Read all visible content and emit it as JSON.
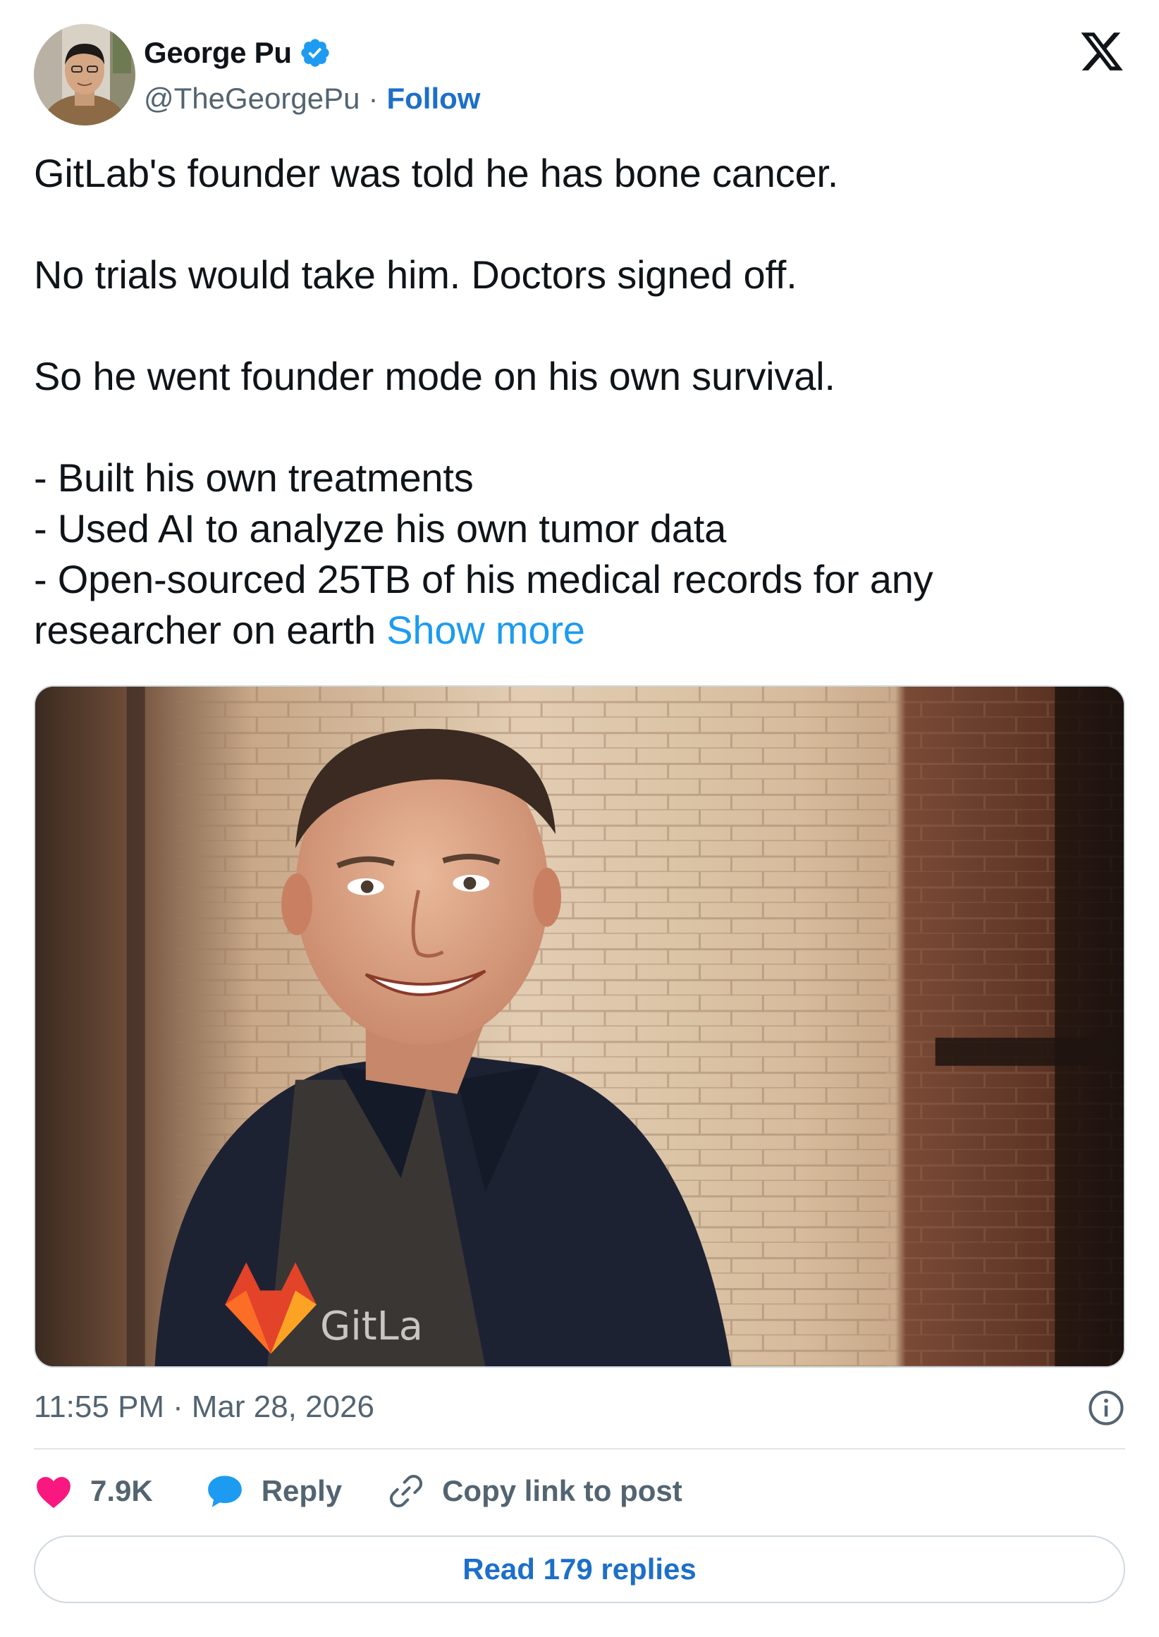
{
  "author": {
    "display_name": "George Pu",
    "handle": "@TheGeorgePu",
    "separator": "·",
    "follow_label": "Follow",
    "verified": true,
    "avatar_icon": "profile-photo"
  },
  "brand": {
    "logo": "x-logo",
    "accent_color": "#1d9bf0",
    "link_color": "#1d6fc9"
  },
  "tweet": {
    "lines": [
      "GitLab's founder was told he has bone cancer.",
      "No trials would take him. Doctors signed off.",
      "So he went founder mode on his own survival.",
      "- Built his own treatments",
      "- Used AI to analyze his own tumor data",
      "- Open-sourced 25TB of his medical records for any",
      "researcher on earth"
    ],
    "show_more_label": "Show more",
    "media": {
      "description_icon": "photo-of-man-in-gitlab-shirt",
      "shirt_text": "GitLa"
    }
  },
  "meta": {
    "time": "11:55 PM",
    "separator": "·",
    "date": "Mar 28, 2026",
    "info_icon": "info-icon"
  },
  "actions": {
    "likes_count": "7.9K",
    "reply_label": "Reply",
    "copy_label": "Copy link to post",
    "like_color": "#f91880",
    "reply_color": "#1d9bf0"
  },
  "read_replies_label": "Read 179 replies"
}
